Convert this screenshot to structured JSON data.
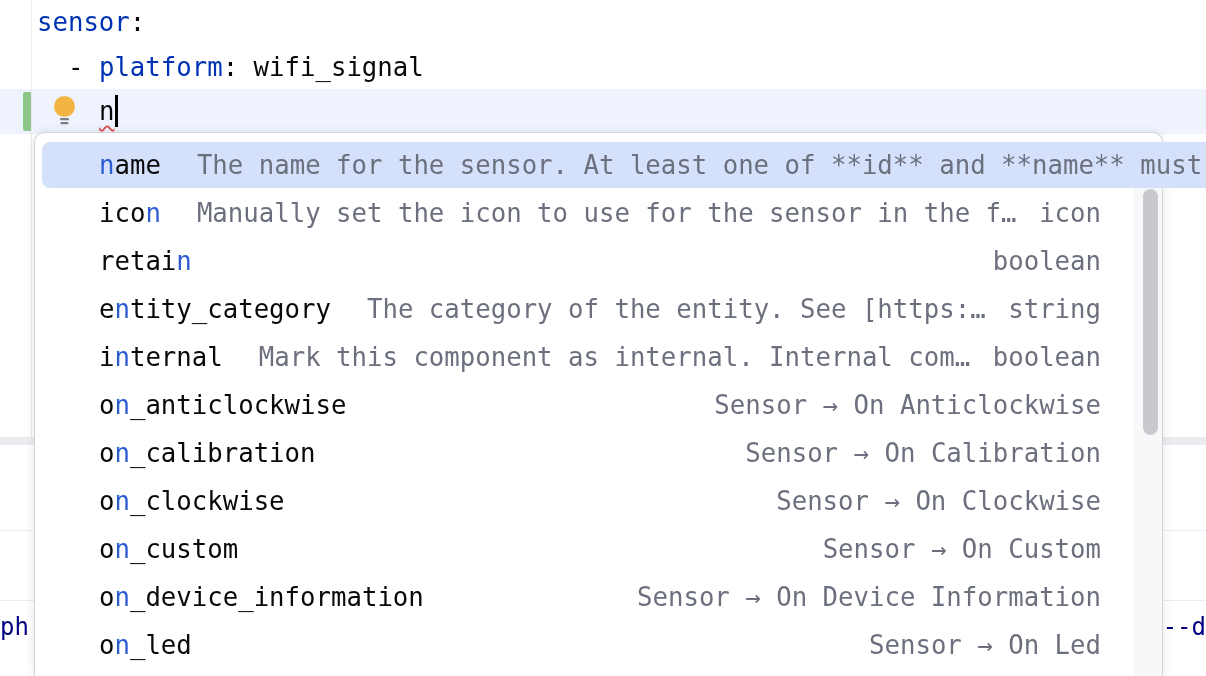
{
  "editor": {
    "lines": [
      {
        "tokens": [
          {
            "text": "sensor",
            "kind": "key",
            "error": false
          },
          {
            "text": ":",
            "kind": "plain",
            "error": false
          }
        ],
        "current": false,
        "changed": false,
        "children": [
          {
            "tokens": [
              {
                "text": "- ",
                "kind": "plain",
                "error": false
              },
              {
                "text": "platform",
                "kind": "key",
                "error": false
              },
              {
                "text": ": wifi_signal",
                "kind": "plain",
                "error": false
              }
            ],
            "current": false,
            "changed": false,
            "children": [
              {
                "tokens": [
                  {
                    "text": "n",
                    "kind": "plain",
                    "error": true
                  }
                ],
                "current": true,
                "changed": true
              }
            ]
          }
        ]
      }
    ]
  },
  "lower_editor": {
    "left_fragment": "ph",
    "right_fragment": "--d"
  },
  "completion_popup": {
    "items": [
      {
        "name_match": "n",
        "name_after": "ame",
        "description": "The name for the sensor. At least one of **id** and **name** must",
        "selected": true
      },
      {
        "name_before": "ico",
        "name_match": "n",
        "description": "Manually set the icon to use for the sensor in the f…",
        "type": "icon",
        "selected": false
      },
      {
        "name_before": "retai",
        "name_match": "n",
        "type": "boolean",
        "selected": false
      },
      {
        "name_before": "e",
        "name_match": "n",
        "name_after": "tity_category",
        "description": "The category of the entity. See [https:…",
        "type": "string",
        "selected": false
      },
      {
        "name_before": "i",
        "name_match": "n",
        "name_after": "ternal",
        "description": "Mark this component as internal. Internal com…",
        "type": "boolean",
        "selected": false
      },
      {
        "name_before": "o",
        "name_match": "n",
        "name_after": "_anticlockwise",
        "type": "Sensor → On Anticlockwise",
        "selected": false
      },
      {
        "name_before": "o",
        "name_match": "n",
        "name_after": "_calibration",
        "type": "Sensor → On Calibration",
        "selected": false
      },
      {
        "name_before": "o",
        "name_match": "n",
        "name_after": "_clockwise",
        "type": "Sensor → On Clockwise",
        "selected": false
      },
      {
        "name_before": "o",
        "name_match": "n",
        "name_after": "_custom",
        "type": "Sensor → On Custom",
        "selected": false
      },
      {
        "name_before": "o",
        "name_match": "n",
        "name_after": "_device_information",
        "type": "Sensor → On Device Information",
        "selected": false
      },
      {
        "name_before": "o",
        "name_match": "n",
        "name_after": "_led",
        "type": "Sensor → On Led",
        "selected": false
      }
    ]
  }
}
